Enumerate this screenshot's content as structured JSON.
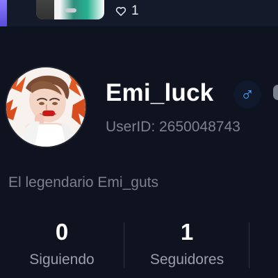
{
  "post": {
    "likes_count": "1",
    "heart_icon": "heart-outline-icon"
  },
  "profile": {
    "username": "Emi_luck",
    "gender_icon": "male-icon",
    "gender_symbol": "♂",
    "user_id": "UserID: 2650048743",
    "bio": "El legendario Emi_guts"
  },
  "stats": {
    "following": {
      "value": "0",
      "label": "Siguiendo"
    },
    "followers": {
      "value": "1",
      "label": "Seguidores"
    }
  },
  "colors": {
    "background": "#0f1320",
    "top_bar": "#151a2a",
    "accent_purple": "#8c7cff",
    "male_blue": "#4aa7ff",
    "secondary_text": "#7d8190",
    "label_text": "#9b9fab"
  }
}
